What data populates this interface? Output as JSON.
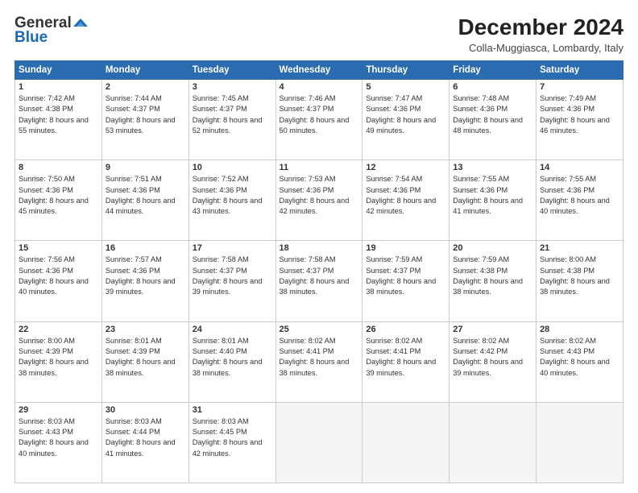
{
  "header": {
    "logo_general": "General",
    "logo_blue": "Blue",
    "month_title": "December 2024",
    "location": "Colla-Muggiasca, Lombardy, Italy"
  },
  "weekdays": [
    "Sunday",
    "Monday",
    "Tuesday",
    "Wednesday",
    "Thursday",
    "Friday",
    "Saturday"
  ],
  "weeks": [
    [
      {
        "day": 1,
        "sunrise": "7:42 AM",
        "sunset": "4:38 PM",
        "daylight": "8 hours and 55 minutes."
      },
      {
        "day": 2,
        "sunrise": "7:44 AM",
        "sunset": "4:37 PM",
        "daylight": "8 hours and 53 minutes."
      },
      {
        "day": 3,
        "sunrise": "7:45 AM",
        "sunset": "4:37 PM",
        "daylight": "8 hours and 52 minutes."
      },
      {
        "day": 4,
        "sunrise": "7:46 AM",
        "sunset": "4:37 PM",
        "daylight": "8 hours and 50 minutes."
      },
      {
        "day": 5,
        "sunrise": "7:47 AM",
        "sunset": "4:36 PM",
        "daylight": "8 hours and 49 minutes."
      },
      {
        "day": 6,
        "sunrise": "7:48 AM",
        "sunset": "4:36 PM",
        "daylight": "8 hours and 48 minutes."
      },
      {
        "day": 7,
        "sunrise": "7:49 AM",
        "sunset": "4:36 PM",
        "daylight": "8 hours and 46 minutes."
      }
    ],
    [
      {
        "day": 8,
        "sunrise": "7:50 AM",
        "sunset": "4:36 PM",
        "daylight": "8 hours and 45 minutes."
      },
      {
        "day": 9,
        "sunrise": "7:51 AM",
        "sunset": "4:36 PM",
        "daylight": "8 hours and 44 minutes."
      },
      {
        "day": 10,
        "sunrise": "7:52 AM",
        "sunset": "4:36 PM",
        "daylight": "8 hours and 43 minutes."
      },
      {
        "day": 11,
        "sunrise": "7:53 AM",
        "sunset": "4:36 PM",
        "daylight": "8 hours and 42 minutes."
      },
      {
        "day": 12,
        "sunrise": "7:54 AM",
        "sunset": "4:36 PM",
        "daylight": "8 hours and 42 minutes."
      },
      {
        "day": 13,
        "sunrise": "7:55 AM",
        "sunset": "4:36 PM",
        "daylight": "8 hours and 41 minutes."
      },
      {
        "day": 14,
        "sunrise": "7:55 AM",
        "sunset": "4:36 PM",
        "daylight": "8 hours and 40 minutes."
      }
    ],
    [
      {
        "day": 15,
        "sunrise": "7:56 AM",
        "sunset": "4:36 PM",
        "daylight": "8 hours and 40 minutes."
      },
      {
        "day": 16,
        "sunrise": "7:57 AM",
        "sunset": "4:36 PM",
        "daylight": "8 hours and 39 minutes."
      },
      {
        "day": 17,
        "sunrise": "7:58 AM",
        "sunset": "4:37 PM",
        "daylight": "8 hours and 39 minutes."
      },
      {
        "day": 18,
        "sunrise": "7:58 AM",
        "sunset": "4:37 PM",
        "daylight": "8 hours and 38 minutes."
      },
      {
        "day": 19,
        "sunrise": "7:59 AM",
        "sunset": "4:37 PM",
        "daylight": "8 hours and 38 minutes."
      },
      {
        "day": 20,
        "sunrise": "7:59 AM",
        "sunset": "4:38 PM",
        "daylight": "8 hours and 38 minutes."
      },
      {
        "day": 21,
        "sunrise": "8:00 AM",
        "sunset": "4:38 PM",
        "daylight": "8 hours and 38 minutes."
      }
    ],
    [
      {
        "day": 22,
        "sunrise": "8:00 AM",
        "sunset": "4:39 PM",
        "daylight": "8 hours and 38 minutes."
      },
      {
        "day": 23,
        "sunrise": "8:01 AM",
        "sunset": "4:39 PM",
        "daylight": "8 hours and 38 minutes."
      },
      {
        "day": 24,
        "sunrise": "8:01 AM",
        "sunset": "4:40 PM",
        "daylight": "8 hours and 38 minutes."
      },
      {
        "day": 25,
        "sunrise": "8:02 AM",
        "sunset": "4:41 PM",
        "daylight": "8 hours and 38 minutes."
      },
      {
        "day": 26,
        "sunrise": "8:02 AM",
        "sunset": "4:41 PM",
        "daylight": "8 hours and 39 minutes."
      },
      {
        "day": 27,
        "sunrise": "8:02 AM",
        "sunset": "4:42 PM",
        "daylight": "8 hours and 39 minutes."
      },
      {
        "day": 28,
        "sunrise": "8:02 AM",
        "sunset": "4:43 PM",
        "daylight": "8 hours and 40 minutes."
      }
    ],
    [
      {
        "day": 29,
        "sunrise": "8:03 AM",
        "sunset": "4:43 PM",
        "daylight": "8 hours and 40 minutes."
      },
      {
        "day": 30,
        "sunrise": "8:03 AM",
        "sunset": "4:44 PM",
        "daylight": "8 hours and 41 minutes."
      },
      {
        "day": 31,
        "sunrise": "8:03 AM",
        "sunset": "4:45 PM",
        "daylight": "8 hours and 42 minutes."
      },
      null,
      null,
      null,
      null
    ]
  ]
}
